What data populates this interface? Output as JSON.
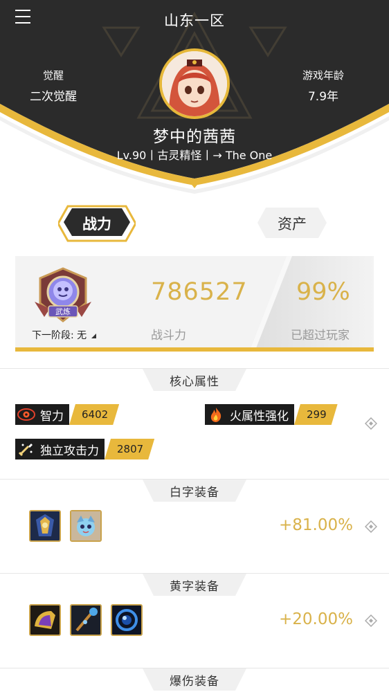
{
  "header": {
    "server": "山东一区",
    "awaken_label": "觉醒",
    "awaken_value": "二次觉醒",
    "age_label": "游戏年龄",
    "age_value": "7.9年",
    "player_name": "梦中的茜茜",
    "player_info": "Lv.90丨古灵精怪丨→   The   One"
  },
  "tabs": {
    "power": "战力",
    "assets": "资产"
  },
  "power_card": {
    "badge_text": "武炼",
    "next_stage": "下一阶段: 无",
    "power_value": "786527",
    "power_label": "战斗力",
    "percent_value": "99%",
    "percent_label": "已超过玩家"
  },
  "core": {
    "title": "核心属性",
    "attrs": [
      {
        "name": "智力",
        "value": "6402",
        "icon": "eye-icon"
      },
      {
        "name": "火属性强化",
        "value": "299",
        "icon": "fire-icon"
      },
      {
        "name": "独立攻击力",
        "value": "2807",
        "icon": "sword-icon"
      }
    ]
  },
  "white_gear": {
    "title": "白字装备",
    "bonus": "+81.00%"
  },
  "yellow_gear": {
    "title": "黄字装备",
    "bonus": "+20.00%"
  },
  "crit_gear": {
    "title": "爆伤装备"
  },
  "colors": {
    "accent": "#e8b83c",
    "header_dark": "#2b2b2b",
    "gold_text": "#d9b24a"
  }
}
